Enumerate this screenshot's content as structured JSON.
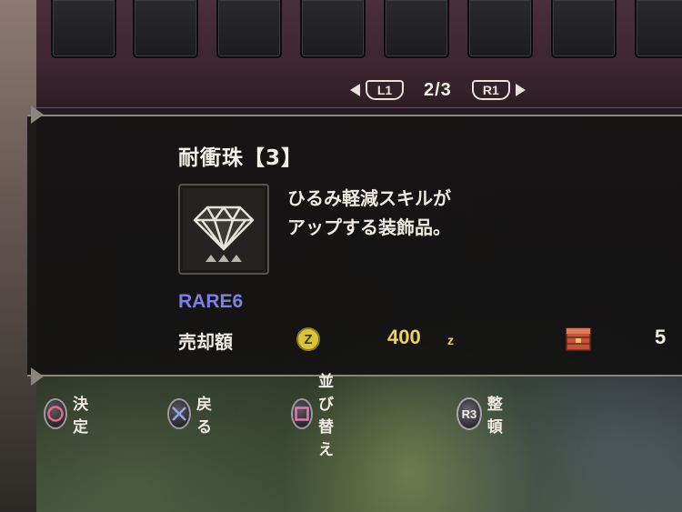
{
  "pager": {
    "left_button": "L1",
    "page": "2/3",
    "right_button": "R1"
  },
  "item": {
    "name": "耐衝珠【3】",
    "description_line1": "ひるみ軽減スキルが",
    "description_line2": "アップする装飾品。",
    "rarity": "RARE6",
    "icon": "jewel-decoration-icon",
    "rarity_color": "#7f7ee8"
  },
  "sell": {
    "label": "売却額",
    "currency_icon": "zenny-icon",
    "currency_symbol": "Z",
    "price": "400",
    "unit": "z",
    "price_color": "#ecd35a"
  },
  "owned": {
    "icon": "item-box-icon",
    "count": "5"
  },
  "controls": {
    "confirm": {
      "glyph": "circle-button-icon",
      "label": "決定"
    },
    "back": {
      "glyph": "cross-button-icon",
      "label": "戻る"
    },
    "sort": {
      "glyph": "square-button-icon",
      "label": "並び替え"
    },
    "organize": {
      "glyph": "R3",
      "label": "整頓"
    }
  }
}
